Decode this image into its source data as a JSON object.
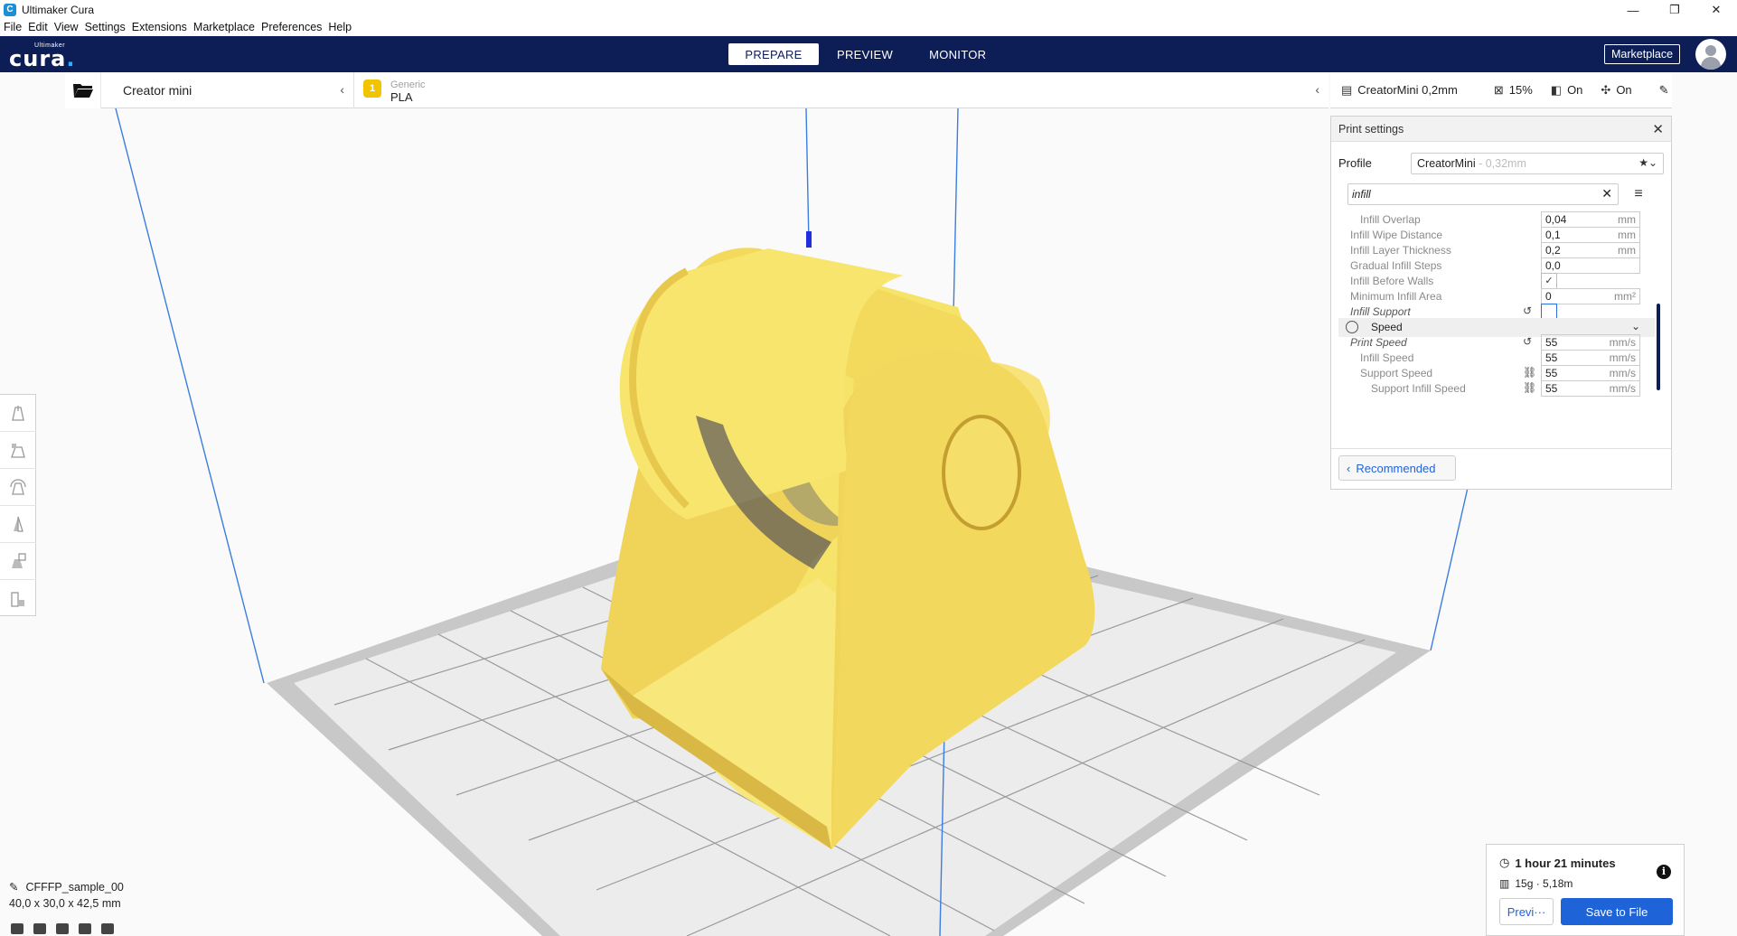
{
  "window": {
    "title": "Ultimaker Cura",
    "minimize": "—",
    "restore": "❐",
    "close": "✕"
  },
  "menu": [
    {
      "label": "File"
    },
    {
      "label": "Edit"
    },
    {
      "label": "View"
    },
    {
      "label": "Settings"
    },
    {
      "label": "Extensions"
    },
    {
      "label": "Marketplace"
    },
    {
      "label": "Preferences"
    },
    {
      "label": "Help"
    }
  ],
  "header": {
    "logo_small": "Ultimaker",
    "logo_big": "cura",
    "logo_dot": ".",
    "tabs": [
      {
        "label": "PREPARE",
        "active": true
      },
      {
        "label": "PREVIEW",
        "active": false
      },
      {
        "label": "MONITOR",
        "active": false
      }
    ],
    "marketplace_label": "Marketplace"
  },
  "machine": {
    "printer_name": "Creator mini",
    "material_brand": "Generic",
    "material_name": "PLA",
    "extruder_number": "1",
    "collapse_icon": "‹"
  },
  "settings_bar": {
    "profile": "CreatorMini 0,2mm",
    "infill": "15%",
    "support": "On",
    "adhesion": "On"
  },
  "print_settings": {
    "title": "Print settings",
    "profile_label": "Profile",
    "profile_value": "CreatorMini",
    "profile_suffix": " - 0,32mm",
    "search_value": "infill",
    "rows": [
      {
        "label": "Infill Overlap",
        "value": "0,04",
        "unit": "mm",
        "type": "field",
        "indent": 1
      },
      {
        "label": "Infill Wipe Distance",
        "value": "0,1",
        "unit": "mm",
        "type": "field",
        "indent": 0
      },
      {
        "label": "Infill Layer Thickness",
        "value": "0,2",
        "unit": "mm",
        "type": "field",
        "indent": 0
      },
      {
        "label": "Gradual Infill Steps",
        "value": "0,0",
        "unit": "",
        "type": "field",
        "indent": 0
      },
      {
        "label": "Infill Before Walls",
        "value": "✓",
        "unit": "",
        "type": "check",
        "indent": 0
      },
      {
        "label": "Minimum Infill Area",
        "value": "0",
        "unit": "mm²",
        "type": "field",
        "indent": 0
      },
      {
        "label": "Infill Support",
        "value": "",
        "unit": "",
        "type": "check-empty",
        "indent": 0,
        "italic": true,
        "reset": "↺"
      },
      {
        "label": "Speed",
        "type": "category"
      },
      {
        "label": "Print Speed",
        "value": "55",
        "unit": "mm/s",
        "type": "field",
        "indent": 0,
        "italic": true,
        "reset": "↺"
      },
      {
        "label": "Infill Speed",
        "value": "55",
        "unit": "mm/s",
        "type": "field",
        "indent": 1
      },
      {
        "label": "Support Speed",
        "value": "55",
        "unit": "mm/s",
        "type": "field",
        "indent": 1,
        "reset": "🔗"
      },
      {
        "label": "Support Infill Speed",
        "value": "55",
        "unit": "mm/s",
        "type": "field",
        "indent": 2,
        "reset": "🔗"
      }
    ],
    "recommended_label": "Recommended"
  },
  "object": {
    "name": "CFFFP_sample_00",
    "dimensions": "40,0 x 30,0 x 42,5 mm"
  },
  "output": {
    "time": "1 hour 21 minutes",
    "material": "15g · 5,18m",
    "preview_label": "Previ···",
    "save_label": "Save to File"
  },
  "colors": {
    "header_bg": "#0d1e56",
    "accent_blue": "#1f63d8",
    "model_yellow": "#f5e05a",
    "material_badge": "#f2c400"
  }
}
